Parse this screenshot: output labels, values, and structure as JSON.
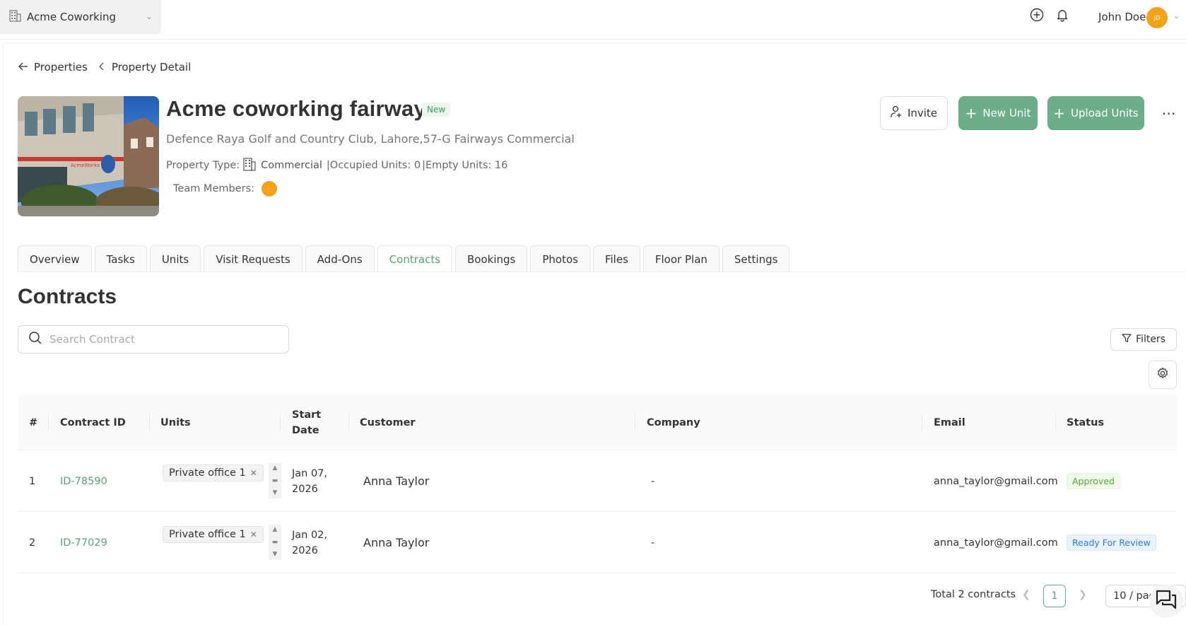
{
  "topbar": {
    "org_name": "Acme Coworking",
    "user_name": "John Doe",
    "user_initials": "JD"
  },
  "breadcrumb": {
    "back_label": "Properties",
    "current_label": "Property Detail"
  },
  "property": {
    "title": "Acme coworking fairways",
    "badge": "New",
    "address": "Defence Raya Golf and Country Club, Lahore,57-G Fairways Commercial",
    "type_label": "Property Type:",
    "type_value": "Commercial",
    "occupied_label": "|Occupied Units: 0",
    "empty_label": "|Empty Units: 16",
    "team_label": "Team Members:"
  },
  "actions": {
    "invite": "Invite",
    "new_unit": "New Unit",
    "upload_units": "Upload Units"
  },
  "tabs": [
    {
      "label": "Overview"
    },
    {
      "label": "Tasks"
    },
    {
      "label": "Units"
    },
    {
      "label": "Visit Requests"
    },
    {
      "label": "Add-Ons"
    },
    {
      "label": "Contracts",
      "active": true
    },
    {
      "label": "Bookings"
    },
    {
      "label": "Photos"
    },
    {
      "label": "Files"
    },
    {
      "label": "Floor Plan"
    },
    {
      "label": "Settings"
    }
  ],
  "contracts": {
    "title": "Contracts",
    "search_placeholder": "Search Contract",
    "filters_label": "Filters",
    "columns": [
      "#",
      "Contract ID",
      "Units",
      "Start Date",
      "Customer",
      "Company",
      "Email",
      "Status"
    ],
    "rows": [
      {
        "num": "1",
        "id": "ID-78590",
        "unit": "Private office 1",
        "start_date_1": "Jan 07,",
        "start_date_2": "2026",
        "customer": "Anna Taylor",
        "company": "-",
        "email": "anna_taylor@gmail.com",
        "status": "Approved"
      },
      {
        "num": "2",
        "id": "ID-77029",
        "unit": "Private office 1",
        "start_date_1": "Jan 02,",
        "start_date_2": "2026",
        "customer": "Anna Taylor",
        "company": "-",
        "email": "anna_taylor@gmail.com",
        "status": "Ready For Review"
      }
    ],
    "pagination": {
      "total": "Total 2 contracts",
      "current_page": "1",
      "page_size": "10 / page"
    }
  },
  "colors": {
    "accent": "#6cae8a",
    "accent_text": "#5a9e7a",
    "avatar": "#f5a21b"
  }
}
